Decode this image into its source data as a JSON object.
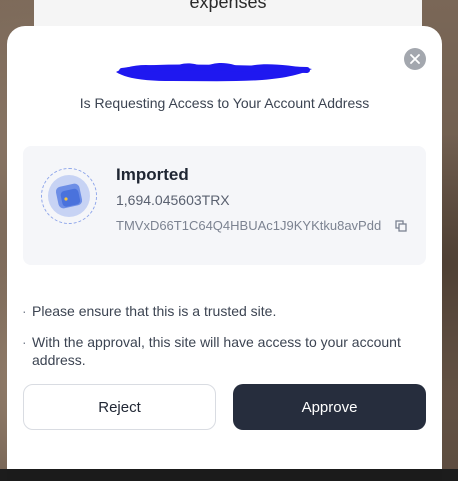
{
  "background": {
    "title": "expenses"
  },
  "modal": {
    "request_text": "Is Requesting Access to Your Account Address",
    "account": {
      "name": "Imported",
      "balance": "1,694.045603TRX",
      "address": "TMVxD66T1C64Q4HBUAc1J9KYKtku8avPdd"
    },
    "notices": [
      "Please ensure that this is a trusted site.",
      "With the approval, this site will have access to your account address."
    ],
    "bullet": "·",
    "buttons": {
      "reject": "Reject",
      "approve": "Approve"
    }
  },
  "colors": {
    "approve_bg": "#262d3d",
    "redaction": "#1f18f0",
    "card_bg": "#f5f6f9"
  },
  "icons": {
    "close": "close-icon",
    "wallet": "wallet-icon",
    "copy": "copy-icon"
  }
}
